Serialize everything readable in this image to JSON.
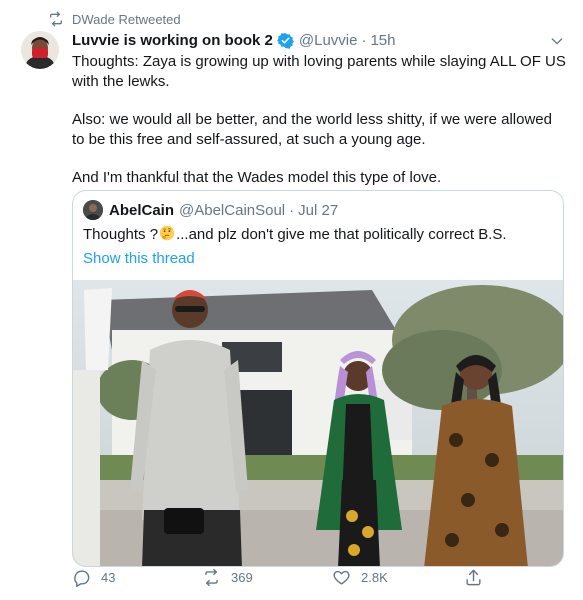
{
  "retweet_banner": {
    "icon": "retweet-icon",
    "text": "DWade Retweeted"
  },
  "tweet": {
    "author_name": "Luvvie is working on book 2",
    "handle": "@Luvvie",
    "separator": "·",
    "time": "15h",
    "verified_color": "#1da1f2",
    "paragraphs": [
      "Thoughts: Zaya is growing up with loving parents while slaying ALL OF US with the lewks.",
      "Also: we would all be better, and the world less shitty, if we were allowed to be this free and self-assured, at such a young age.",
      "And I'm thankful that the Wades model this type of love."
    ]
  },
  "quoted_tweet": {
    "author_name": "AbelCain",
    "handle": "@AbelCainSoul",
    "separator": "·",
    "time": "Jul 27",
    "text_before_emoji": "Thoughts ?",
    "emoji": "thinking-face-emoji",
    "text_after_emoji": "...and plz don't give me that politically correct B.S.",
    "show_thread": "Show this thread"
  },
  "actions": {
    "reply_count": "43",
    "retweet_count": "369",
    "like_count": "2.8K"
  },
  "colors": {
    "link": "#1da1f2",
    "secondary_text": "#657786",
    "border": "#ccd6dd",
    "primary_text": "#14171a"
  }
}
